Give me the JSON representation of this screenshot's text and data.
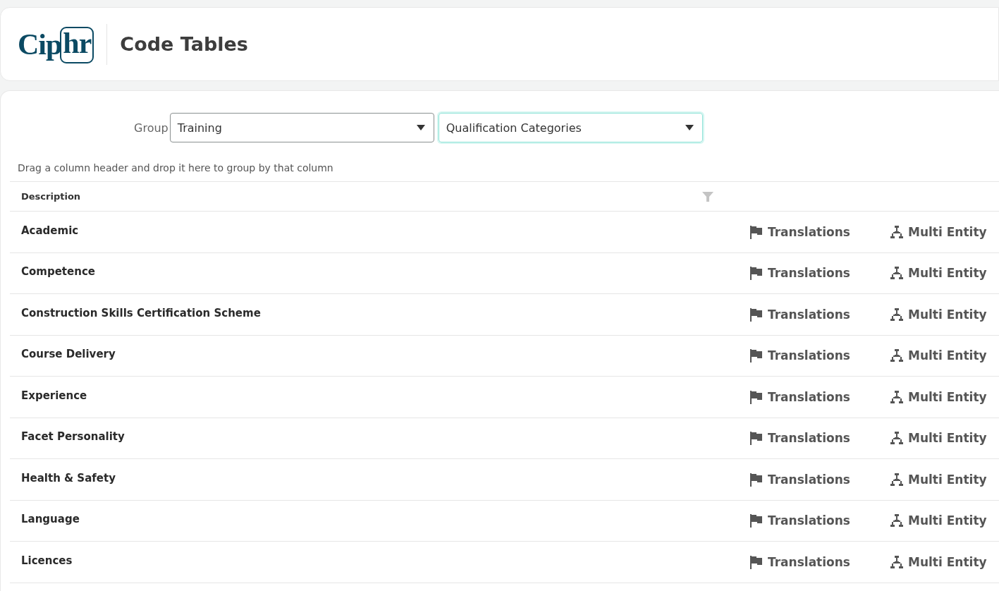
{
  "header": {
    "logo": "Ciphr",
    "title": "Code Tables"
  },
  "filters": {
    "label": "Group",
    "selects": [
      {
        "value": "Training",
        "focused": false
      },
      {
        "value": "Qualification Categories",
        "focused": true
      }
    ]
  },
  "group_hint": "Drag a column header and drop it here to group by that column",
  "table": {
    "columns": [
      "Description"
    ],
    "rows": [
      {
        "description": "Academic",
        "actions": [
          "Translations",
          "Multi Entity"
        ]
      },
      {
        "description": "Competence",
        "actions": [
          "Translations",
          "Multi Entity"
        ]
      },
      {
        "description": "Construction Skills Certification Scheme",
        "actions": [
          "Translations",
          "Multi Entity"
        ]
      },
      {
        "description": "Course Delivery",
        "actions": [
          "Translations",
          "Multi Entity"
        ]
      },
      {
        "description": "Experience",
        "actions": [
          "Translations",
          "Multi Entity"
        ]
      },
      {
        "description": "Facet Personality",
        "actions": [
          "Translations",
          "Multi Entity"
        ]
      },
      {
        "description": "Health & Safety",
        "actions": [
          "Translations",
          "Multi Entity"
        ]
      },
      {
        "description": "Language",
        "actions": [
          "Translations",
          "Multi Entity"
        ]
      },
      {
        "description": "Licences",
        "actions": [
          "Translations",
          "Multi Entity"
        ]
      }
    ]
  }
}
